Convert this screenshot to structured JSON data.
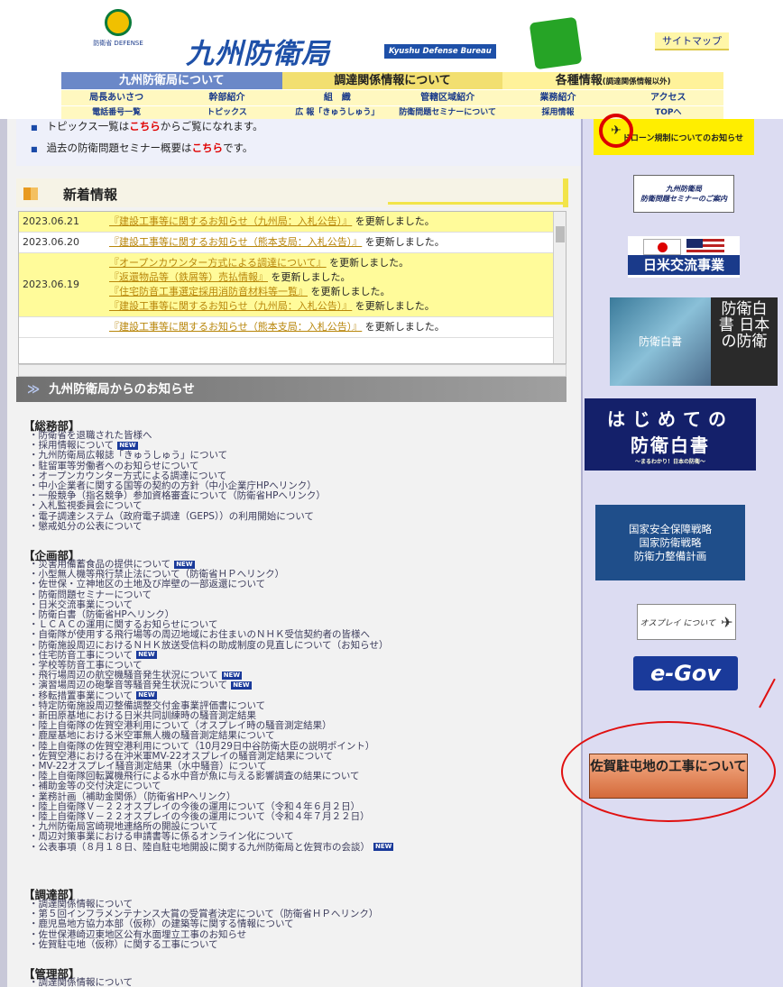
{
  "header": {
    "logo_text": "防衛省 DEFENSE",
    "title": "九州防衛局",
    "title_en": "Kyushu Defense Bureau",
    "sitemap": "サイトマップ"
  },
  "nav": {
    "tabs": [
      "九州防衛局について",
      "調達関係情報について",
      "各種情報"
    ],
    "tab3_note": "(調達関係情報以外)",
    "row2": [
      "局長あいさつ",
      "幹部紹介",
      "組　織",
      "管轄区域紹介",
      "業務紹介",
      "アクセス"
    ],
    "row3": [
      "電話番号一覧",
      "トピックス",
      "広 報「きゅうしゅう」",
      "防衛問題セミナーについて",
      "採用情報",
      "TOPへ"
    ]
  },
  "topics": {
    "line1_pre": "トピックス一覧は",
    "line1_link": "こちら",
    "line1_post": "からご覧になれます。",
    "line2_pre": "過去の防衛問題セミナー概要は",
    "line2_link": "こちら",
    "line2_post": "です。"
  },
  "news": {
    "heading": "新着情報",
    "rows": [
      {
        "date": "2023.06.21",
        "items": [
          "『建設工事等に関するお知らせ（九州局：入札公告）』"
        ],
        "suffix": "を更新しました。",
        "hl": true
      },
      {
        "date": "2023.06.20",
        "items": [
          "『建設工事等に関するお知らせ（熊本支局：入札公告）』"
        ],
        "suffix": "を更新しました。",
        "hl": false
      },
      {
        "date": "2023.06.19",
        "items": [
          "『オープンカウンター方式による調達について』",
          "『返還物品等（鉄屑等）売払情報』",
          "『住宅防音工事選定採用消防音材料等一覧』",
          "『建設工事等に関するお知らせ（九州局：入札公告）』"
        ],
        "suffix": "を更新しました。",
        "hl": true
      },
      {
        "date": "",
        "items": [
          "『建設工事等に関するお知らせ（熊本支局：入札公告）』"
        ],
        "suffix": "を更新しました。",
        "hl": false
      }
    ]
  },
  "info": {
    "heading": "九州防衛局からのお知らせ"
  },
  "sections": {
    "soumu": {
      "title": "【総務部】",
      "items": [
        "防衛省を退職された皆様へ",
        "採用情報について",
        "九州防衛局広報誌「きゅうしゅう」について",
        "駐留軍等労働者へのお知らせについて",
        "オープンカウンター方式による調達について",
        "中小企業者に関する国等の契約の方針（中小企業庁HPへリンク）",
        "一般競争（指名競争）参加資格審査について（防衛省HPへリンク）",
        "入札監視委員会について",
        "電子調達システム（政府電子調達（GEPS））の利用開始について",
        "懲戒処分の公表について"
      ]
    },
    "kikaku": {
      "title": "【企画部】",
      "items": [
        "災害用備蓄食品の提供について",
        "小型無人機等飛行禁止法について（防衛省ＨＰへリンク）",
        "佐世保・立神地区の土地及び岸壁の一部返還について",
        "防衛問題セミナーについて",
        "日米交流事業について",
        "防衛白書（防衛省HPへリンク）",
        "ＬＣＡＣの運用に関するお知らせについて",
        "自衛隊が使用する飛行場等の周辺地域にお住まいのＮＨＫ受信契約者の皆様へ",
        "防衛施設周辺におけるＮＨＫ放送受信料の助成制度の見直しについて（お知らせ）",
        "住宅防音工事について",
        "学校等防音工事について",
        "飛行場周辺の航空機騒音発生状況について",
        "演習場周辺の砲撃音等騒音発生状況について",
        "移転措置事業について",
        "特定防衛施設周辺整備調整交付金事業評価書について",
        "新田原基地における日米共同訓練時の騒音測定結果",
        "陸上自衛隊の佐賀空港利用について（オスプレイ時の騒音測定結果）",
        "鹿屋基地における米空軍無人機の騒音測定結果について",
        "陸上自衛隊の佐賀空港利用について（10月29日中谷防衛大臣の説明ポイント）",
        "佐賀空港における在沖米軍MV-22オスプレイの騒音測定結果について",
        "MV-22オスプレイ騒音測定結果（水中騒音）について",
        "陸上自衛隊回転翼機飛行による水中音が魚に与える影響調査の結果について",
        "補助金等の交付決定について",
        "業務計画（補助金関係）（防衛省HPへリンク）",
        "陸上自衛隊Ｖ－２２オスプレイの今後の運用について（令和４年６月２日）",
        "陸上自衛隊Ｖ－２２オスプレイの今後の運用について（令和４年７月２２日）",
        "九州防衛局宮崎現地連絡所の開設について",
        "周辺対策事業における申請書等に係るオンライン化について",
        "公表事項（８月１８日、陸自駐屯地開設に関する九州防衛局と佐賀市の会談）"
      ]
    },
    "choutatsu": {
      "title": "【調達部】",
      "items": [
        "調達関係情報について",
        "第５回インフラメンテナンス大賞の受賞者決定について（防衛省ＨＰへリンク）",
        "鹿児島地方協力本部（仮称）の建築等に関する情報について",
        "佐世保港崎辺東地区公有水面埋立工事のお知らせ",
        "佐賀駐屯地（仮称）に関する工事について"
      ]
    },
    "kanri": {
      "title": "【管理部】",
      "items": [
        "調達関係情報について"
      ]
    }
  },
  "new_badge": "NEW",
  "sidebar": {
    "drone": "ドローン規制についてのお知らせ",
    "seminar_1": "九州防衛局",
    "seminar_2": "防衛問題セミナーのご案内",
    "usjp": "日米交流事業",
    "whitepaper_img": "防衛白書",
    "whitepaper_txt": "防衛白書 日本の防衛",
    "hajime_1": "はじめての",
    "hajime_2": "防衛白書",
    "hajime_3": "～まるわかり！日本の防衛～",
    "kokka": [
      "国家安全保障戦略",
      "国家防衛戦略",
      "防衛力整備計画"
    ],
    "osprey": "オスプレイ について",
    "egov": "e-Gov",
    "saga": "佐賀駐屯地の工事について"
  },
  "colors": {
    "accent_blue": "#1e50a8",
    "highlight_yellow": "#fffb9a",
    "callout_red": "#e01010"
  }
}
